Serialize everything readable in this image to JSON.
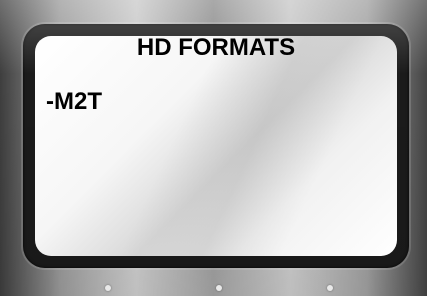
{
  "screen": {
    "title": "HD FORMATS",
    "items": [
      "-M2T"
    ]
  },
  "indicators": {
    "count": 3
  }
}
